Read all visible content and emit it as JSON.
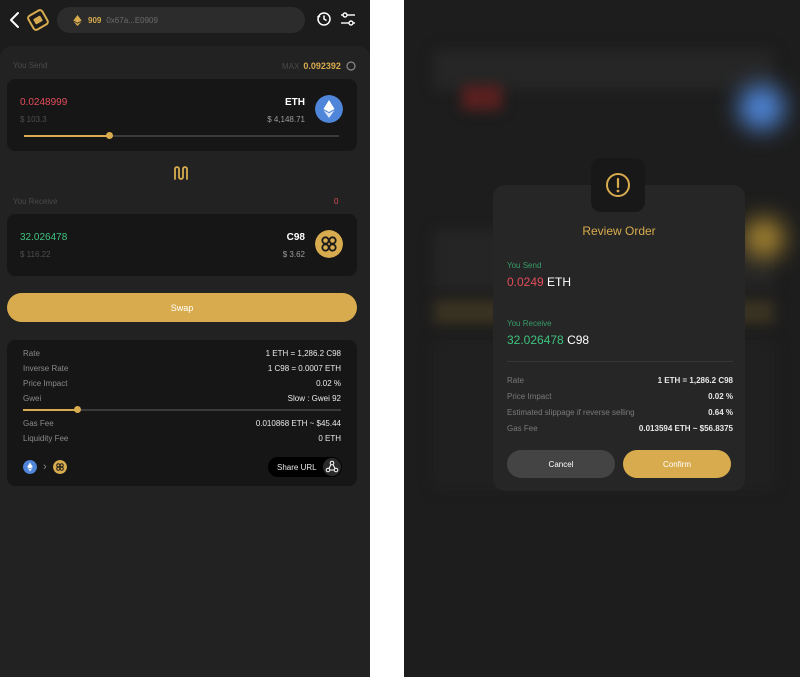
{
  "header": {
    "balance": "909",
    "address": "0x67a...E0909"
  },
  "send": {
    "section_label": "You Send",
    "max_label": "MAX",
    "max_value": "0.092392",
    "amount": "0.0248999",
    "usd_value": "$ 103.3",
    "token_symbol": "ETH",
    "token_usd": "$ 4,148.71",
    "token_icon": "ethereum-icon",
    "slider_fraction": 0.27
  },
  "receive": {
    "section_label": "You Receive",
    "count": "0",
    "amount": "32.026478",
    "usd_value": "$ 116.22",
    "token_symbol": "C98",
    "token_usd": "$ 3.62",
    "token_icon": "c98-icon"
  },
  "swap_button": "Swap",
  "details": {
    "rate_label": "Rate",
    "rate_value": "1 ETH = 1,286.2 C98",
    "inverse_label": "Inverse Rate",
    "inverse_value": "1 C98 = 0.0007 ETH",
    "impact_label": "Price Impact",
    "impact_value": "0.02 %",
    "gwei_label": "Gwei",
    "gwei_value": "Slow : Gwei 92",
    "gwei_fraction": 0.17,
    "gas_label": "Gas Fee",
    "gas_value": "0.010868 ETH ~ $45.44",
    "liquidity_label": "Liquidity Fee",
    "liquidity_value": "0 ETH",
    "share_label": "Share URL"
  },
  "dialog": {
    "title": "Review Order",
    "send_label": "You Send",
    "send_amount": "0.0249",
    "send_symbol": "ETH",
    "receive_label": "You Receive",
    "receive_amount": "32.026478",
    "receive_symbol": "C98",
    "rate_label": "Rate",
    "rate_value": "1 ETH = 1,286.2 C98",
    "impact_label": "Price Impact",
    "impact_value": "0.02 %",
    "slippage_label": "Estimated slippage if reverse selling",
    "slippage_value": "0.64 %",
    "gas_label": "Gas Fee",
    "gas_value": "0.013594 ETH ~ $56.8375",
    "cancel_label": "Cancel",
    "confirm_label": "Confirm"
  },
  "colors": {
    "accent": "#d8ac4e",
    "negative": "#e34d5b",
    "positive": "#3ec27e",
    "background": "#1c1c1c"
  }
}
